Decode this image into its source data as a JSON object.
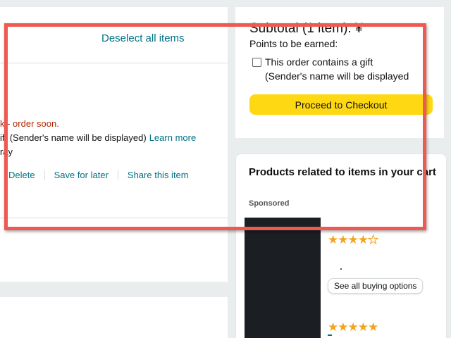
{
  "cart": {
    "deselect_label": "Deselect all items",
    "stock_text": "k - order soon.",
    "gift_text": "ift (Sender's name will be displayed)",
    "gift_learn_more": "Learn more",
    "color_text": "ray",
    "actions": {
      "delete": "Delete",
      "save_for_later": "Save for later",
      "share": "Share this item"
    }
  },
  "subtotal": {
    "title": "Subtotal (1 item): ¥",
    "points_label": "Points to be earned:",
    "gift_checkbox_label": "This order contains a gift",
    "gift_checkbox_sub": "(Sender's name will be displayed",
    "checkout_label": "Proceed to Checkout"
  },
  "related": {
    "title": "Products related to items in your cart",
    "sponsored_label": "Sponsored",
    "products": [
      {
        "rating_stars": "★★★★",
        "rating": 4.5,
        "half_star": "★"
      },
      {
        "rating_stars": "★★★★★",
        "rating": 5
      }
    ],
    "see_all_label": "See all buying options"
  },
  "colors": {
    "link": "#007185",
    "alert": "#b12704",
    "checkout_button": "#ffd814",
    "star": "#f4a41c",
    "highlight_border": "#ee5a52"
  }
}
